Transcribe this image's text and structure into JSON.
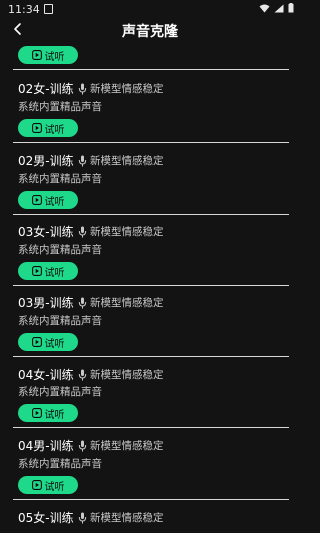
{
  "status_bar": {
    "time": "11:34"
  },
  "header": {
    "title": "声音克隆"
  },
  "top_button_label": "试听",
  "cards": [
    {
      "name": "02女-训练",
      "tag": "新模型情感稳定",
      "desc": "系统内置精品声音",
      "button": "试听"
    },
    {
      "name": "02男-训练",
      "tag": "新模型情感稳定",
      "desc": "系统内置精品声音",
      "button": "试听"
    },
    {
      "name": "03女-训练",
      "tag": "新模型情感稳定",
      "desc": "系统内置精品声音",
      "button": "试听"
    },
    {
      "name": "03男-训练",
      "tag": "新模型情感稳定",
      "desc": "系统内置精品声音",
      "button": "试听"
    },
    {
      "name": "04女-训练",
      "tag": "新模型情感稳定",
      "desc": "系统内置精品声音",
      "button": "试听"
    },
    {
      "name": "04男-训练",
      "tag": "新模型情感稳定",
      "desc": "系统内置精品声音",
      "button": "试听"
    },
    {
      "name": "05女-训练",
      "tag": "新模型情感稳定",
      "desc": "",
      "button": ""
    }
  ],
  "colors": {
    "background": "#131313",
    "accent": "#1ed98a",
    "divider": "#d8d8d8"
  }
}
